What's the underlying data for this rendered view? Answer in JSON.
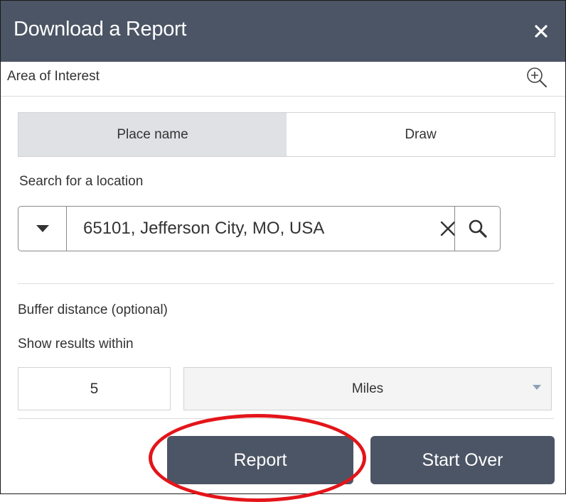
{
  "header": {
    "title": "Download a Report",
    "close_icon": "close-icon",
    "background_color": "#4c5565"
  },
  "area_of_interest": {
    "label": "Area of Interest",
    "zoom_icon": "zoom-in-icon"
  },
  "tabs": [
    {
      "label": "Place name",
      "active": true
    },
    {
      "label": "Draw",
      "active": false
    }
  ],
  "search": {
    "label": "Search for a location",
    "value": "65101, Jefferson City, MO, USA",
    "dropdown_icon": "caret-down-icon",
    "clear_icon": "clear-icon",
    "search_icon": "search-icon"
  },
  "buffer": {
    "label": "Buffer distance (optional)",
    "within_label": "Show results within",
    "distance": "5",
    "units": "Miles",
    "units_icon": "chevron-down-icon"
  },
  "actions": {
    "report_label": "Report",
    "start_over_label": "Start Over",
    "button_color": "#4c5565"
  },
  "annotation": {
    "highlight_color": "#e3151a"
  }
}
